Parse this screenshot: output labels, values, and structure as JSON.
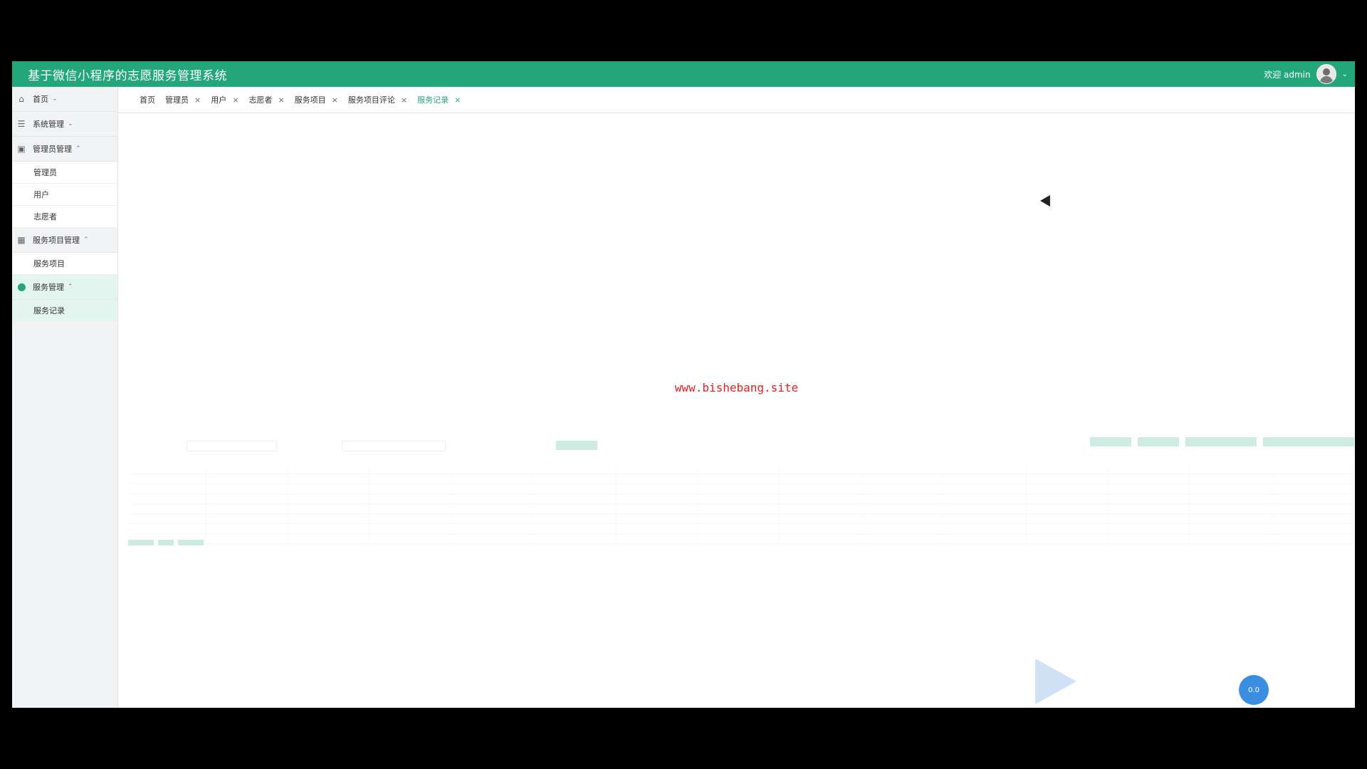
{
  "header": {
    "title": "基于微信小程序的志愿服务管理系统",
    "welcome": "欢迎 admin",
    "chevron": "chevron-down-icon"
  },
  "sidebar": {
    "items": [
      {
        "label": "首页",
        "icon": "home-icon",
        "chevron": "⌄"
      },
      {
        "label": "系统管理",
        "icon": "menu-icon",
        "chevron": "⌄"
      },
      {
        "label": "管理员管理",
        "icon": "briefcase-icon",
        "chevron": "⌃",
        "children": [
          "管理员",
          "用户",
          "志愿者"
        ]
      },
      {
        "label": "服务项目管理",
        "icon": "grid-icon",
        "chevron": "⌃",
        "children": [
          "服务项目"
        ]
      },
      {
        "label": "服务管理",
        "icon": "circle-icon",
        "chevron": "⌃",
        "children": [
          "服务记录"
        ]
      }
    ]
  },
  "tabs": [
    {
      "label": "首页",
      "closable": false
    },
    {
      "label": "管理员",
      "closable": true
    },
    {
      "label": "用户",
      "closable": true
    },
    {
      "label": "志愿者",
      "closable": true
    },
    {
      "label": "服务项目",
      "closable": true
    },
    {
      "label": "服务项目评论",
      "closable": true
    },
    {
      "label": "服务记录",
      "closable": true,
      "active": true
    }
  ],
  "close_glyph": "×",
  "watermark": "www.bishebang.site",
  "float_button": "0.0"
}
